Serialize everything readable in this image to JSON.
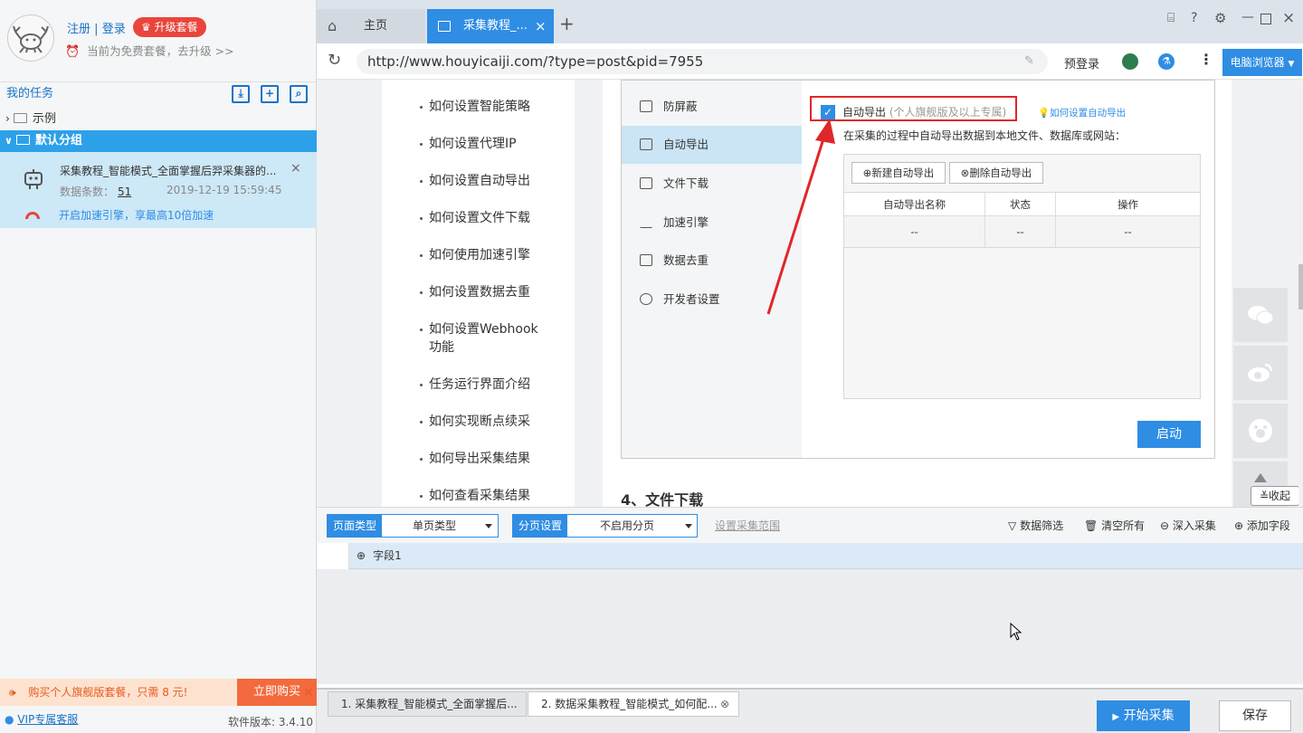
{
  "sidebar": {
    "register_label": "注册",
    "separator": "|",
    "login_label": "登录",
    "upgrade_label": "升级套餐",
    "plan_status": "当前为免费套餐，去升级 >>",
    "my_tasks_title": "我的任务",
    "groups": [
      {
        "name": "示例",
        "expanded": false
      },
      {
        "name": "默认分组",
        "expanded": true
      }
    ],
    "task": {
      "title": "采集教程_智能模式_全面掌握后羿采集器的...",
      "count_label": "数据条数：",
      "count_value": "51",
      "timestamp": "2019-12-19 15:59:45",
      "boost_text": "开启加速引擎，享最高10倍加速"
    },
    "promo_text": "购买个人旗舰版套餐，只需 8 元!",
    "buy_label": "立即购买",
    "vip_service": "VIP专属客服",
    "version": "软件版本: 3.4.10"
  },
  "browser": {
    "tabs": [
      {
        "label": "主页",
        "active": false
      },
      {
        "label": "采集教程_...",
        "active": true
      }
    ],
    "url": "http://www.houyicaiji.com/?type=post&pid=7955",
    "prelogin_label": "预登录",
    "browser_mode": "电脑浏览器"
  },
  "page": {
    "toc": [
      "如何设置智能策略",
      "如何设置代理IP",
      "如何设置自动导出",
      "如何设置文件下载",
      "如何使用加速引擎",
      "如何设置数据去重",
      "如何设置Webhook功能",
      "任务运行界面介绍",
      "如何实现断点续采",
      "如何导出采集结果",
      "如何查看采集结果"
    ],
    "screenshot": {
      "nav": [
        "防屏蔽",
        "自动导出",
        "文件下载",
        "加速引擎",
        "数据去重",
        "开发者设置"
      ],
      "active_nav": "自动导出",
      "checkbox_label": "自动导出",
      "checkbox_note": "(个人旗舰版及以上专属)",
      "help_link": "如何设置自动导出",
      "description": "在采集的过程中自动导出数据到本地文件、数据库或网站：",
      "new_button": "新建自动导出",
      "delete_button": "删除自动导出",
      "table_headers": [
        "自动导出名称",
        "状态",
        "操作"
      ],
      "table_row": [
        "--",
        "--",
        "--"
      ],
      "start_button": "启动"
    },
    "section_heading": "4、文件下载",
    "collapse_label": "收起"
  },
  "toolbar": {
    "page_type_label": "页面类型",
    "page_type_value": "单页类型",
    "pagination_label": "分页设置",
    "pagination_value": "不启用分页",
    "set_range": "设置采集范围",
    "filter": "数据筛选",
    "clear_all": "清空所有",
    "deep_collect": "深入采集",
    "add_field": "添加字段"
  },
  "fields": [
    "字段1"
  ],
  "footer": {
    "tabs": [
      "1. 采集教程_智能模式_全面掌握后...",
      "2. 数据采集教程_智能模式_如何配..."
    ],
    "start_label": "开始采集",
    "save_label": "保存"
  },
  "colors": {
    "accent": "#2f8de4",
    "danger": "#e9453c",
    "selected_group": "#2da0ea",
    "task_bg": "#cde8f7"
  }
}
